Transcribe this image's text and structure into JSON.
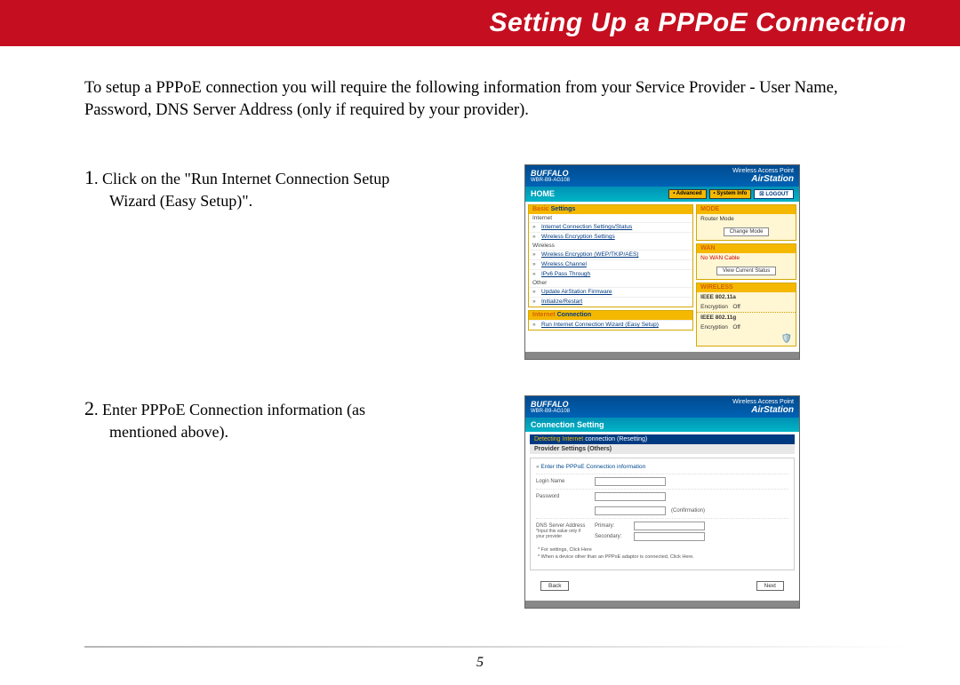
{
  "header": {
    "title": "Setting Up a PPPoE Connection"
  },
  "intro": "To setup a PPPoE connection you will require the following information from your Service Provider - User Name, Password, DNS Server Address (only if required by your provider).",
  "steps": {
    "s1": {
      "num": "1",
      "text_a": ". Click on the \"Run Internet Connection Setup",
      "text_b": "Wizard (Easy Setup)\"."
    },
    "s2": {
      "num": "2",
      "text_a": ". Enter PPPoE Connection information (as",
      "text_b": "mentioned above)."
    }
  },
  "shot1": {
    "brand": "BUFFALO",
    "model": "WBR-B9-AG108",
    "tagline": "Wireless Access Point",
    "product": "AirStation",
    "home": "HOME",
    "btn_adv": "• Advanced",
    "btn_sys": "• System Info",
    "btn_logout": "☒ LOGOUT",
    "basic_head_a": "Basic",
    "basic_head_b": " Settings",
    "internet": "Internet",
    "link1": "Internet Connection Settings/Status",
    "link2": "Wireless Encryption Settings",
    "wireless": "Wireless",
    "link3": "Wireless Encryption (WEP/TKIP/AES)",
    "link4": "Wireless Channel",
    "link5": "IPv6 Pass Through",
    "other": "Other",
    "link6": "Update AirStation Firmware",
    "link7": "Initialize/Restart",
    "ic_head_a": "Internet",
    "ic_head_b": " Connection",
    "ic_link": "Run Internet Connection Wizard (Easy Setup)",
    "mode_head": "MODE",
    "mode_val": "Router Mode",
    "mode_btn": "Change Mode",
    "wan_head": "WAN",
    "wan_val": "No WAN Cable",
    "wan_btn": "View Current Status",
    "wl_head": "WIRELESS",
    "wl_11a": "IEEE 802.11a",
    "wl_11g": "IEEE 802.11g",
    "enc": "Encryption",
    "off": "Off"
  },
  "shot2": {
    "brand": "BUFFALO",
    "model": "WBR-B9-AG108",
    "tagline": "Wireless Access Point",
    "product": "AirStation",
    "conn_set": "Connection Setting",
    "det_a": "Detecting Internet",
    "det_b": " connection (Resetting)",
    "provider": "Provider Settings (Others)",
    "form_head": "Enter the PPPoE Connection information",
    "login": "Login Name",
    "password": "Password",
    "confirm": "(Confirmation)",
    "dns_label": "DNS Server Address",
    "dns_note": "*Input this value only if your provider",
    "primary": "Primary:",
    "secondary": "Secondary:",
    "note1": "* For settings, Click Here",
    "note2": "* When a device other than an PPPoE adaptor is connected, Click Here.",
    "back": "Back",
    "next": "Next"
  },
  "page_number": "5"
}
